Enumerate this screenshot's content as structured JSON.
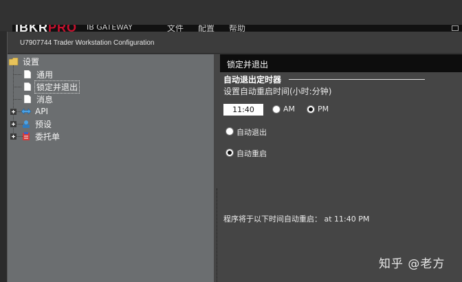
{
  "background_app": {
    "logo_main": "IBKR",
    "logo_pro": "PRO",
    "title": "IB GATEWAY",
    "menus": [
      "文件",
      "配置",
      "帮助"
    ]
  },
  "window": {
    "title": "U7907744 Trader Workstation Configuration"
  },
  "tree": {
    "root": {
      "label": "设置",
      "icon": "folder-icon"
    },
    "items": [
      {
        "label": "通用",
        "icon": "document-icon"
      },
      {
        "label": "锁定并退出",
        "icon": "document-icon",
        "selected": true
      },
      {
        "label": "消息",
        "icon": "document-icon"
      },
      {
        "label": "API",
        "icon": "api-arrows-icon",
        "expandable": true
      },
      {
        "label": "预设",
        "icon": "presets-icon",
        "expandable": true
      },
      {
        "label": "委托单",
        "icon": "orders-icon",
        "expandable": true
      }
    ]
  },
  "panel": {
    "header": "锁定并退出",
    "group_title": "自动退出定时器",
    "setting_label": "设置自动重启时间(小时:分钟)",
    "time_value": "11:40",
    "ampm": {
      "am_label": "AM",
      "pm_label": "PM",
      "selected": "PM"
    },
    "mode": {
      "exit_label": "自动退出",
      "restart_label": "自动重启",
      "selected": "restart"
    },
    "status_text": "程序将于以下时间自动重启： at 11:40 PM"
  },
  "watermark": "知乎 @老方",
  "colors": {
    "tree_bg": "#6b6e70",
    "panel_bg": "#454545",
    "header_bg": "#0d0d0d",
    "brand_red": "#c8102e"
  }
}
